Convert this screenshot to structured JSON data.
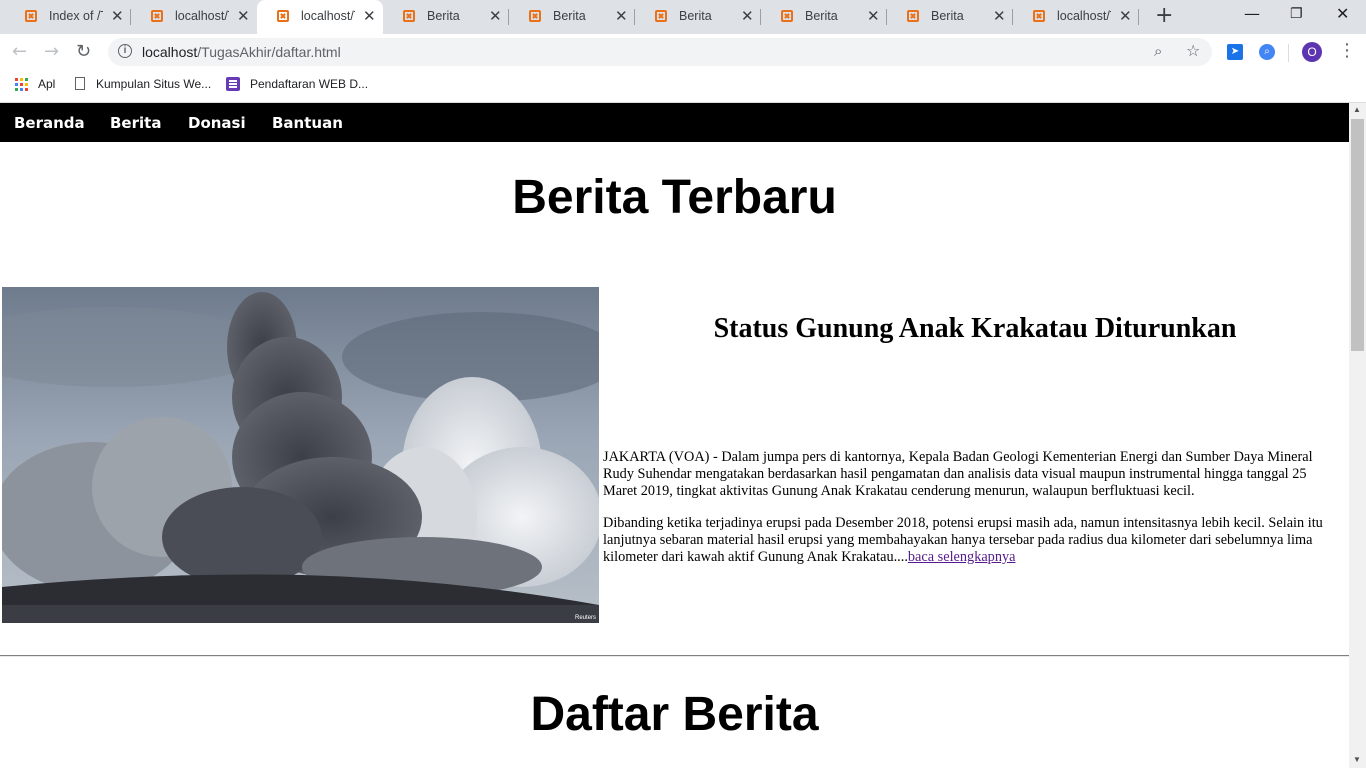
{
  "browser": {
    "tabs": [
      {
        "title": "Index of /Tu",
        "active": false
      },
      {
        "title": "localhost/Tu",
        "active": false
      },
      {
        "title": "localhost/Tu",
        "active": true
      },
      {
        "title": "Berita",
        "active": false
      },
      {
        "title": "Berita",
        "active": false
      },
      {
        "title": "Berita",
        "active": false
      },
      {
        "title": "Berita",
        "active": false
      },
      {
        "title": "Berita",
        "active": false
      },
      {
        "title": "localhost/Tu",
        "active": false
      }
    ],
    "url_host": "localhost",
    "url_path": "/TugasAkhir/daftar.html",
    "profile_initial": "O",
    "bookmarks": [
      "Apl",
      "Kumpulan Situs We...",
      "Pendaftaran WEB D..."
    ],
    "colors": {
      "tab_strip": "#dee1e6",
      "favicon": "#e8711a",
      "profile": "#5e35b1"
    }
  },
  "site": {
    "nav": [
      "Beranda",
      "Berita",
      "Donasi",
      "Bantuan"
    ],
    "heading_latest": "Berita Terbaru",
    "featured": {
      "image_credit": "Reuters",
      "title": "Status Gunung Anak Krakatau Diturunkan",
      "paragraph1": "JAKARTA (VOA) - Dalam jumpa pers di kantornya, Kepala Badan Geologi Kementerian Energi dan Sumber Daya Mineral Rudy Suhendar mengatakan berdasarkan hasil pengamatan dan analisis data visual maupun instrumental hingga tanggal 25 Maret 2019, tingkat aktivitas Gunung Anak Krakatau cenderung menurun, walaupun berfluktuasi kecil.",
      "paragraph2": "Dibanding ketika terjadinya erupsi pada Desember 2018, potensi erupsi masih ada, namun intensitasnya lebih kecil. Selain itu lanjutnya sebaran material hasil erupsi yang membahayakan hanya tersebar pada radius dua kilometer dari sebelumnya lima kilometer dari kawah aktif Gunung Anak Krakatau....",
      "read_more": "baca selengkapnya"
    },
    "heading_list": "Daftar Berita"
  }
}
